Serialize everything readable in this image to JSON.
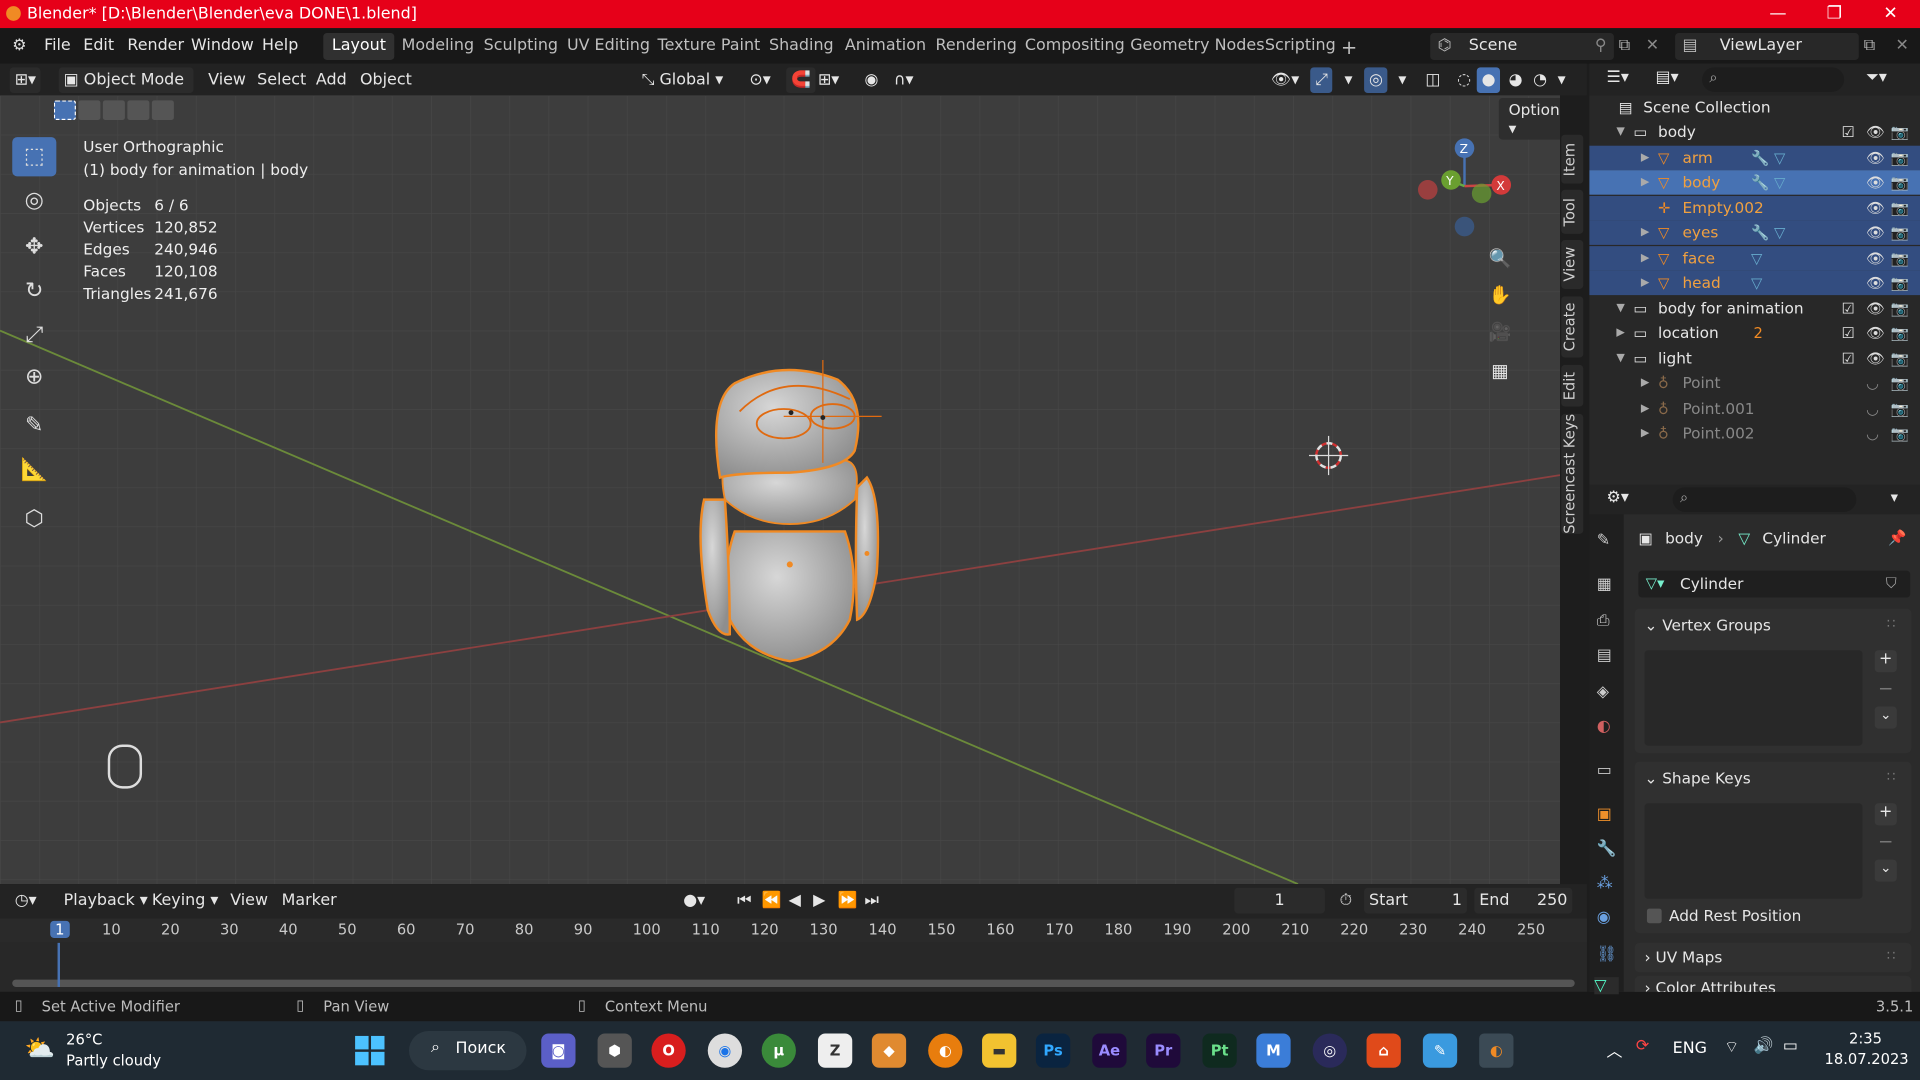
{
  "window": {
    "title": "Blender* [D:\\Blender\\Blender\\eva DONE\\1.blend]"
  },
  "menu": [
    "File",
    "Edit",
    "Render",
    "Window",
    "Help"
  ],
  "workspaces": [
    "Layout",
    "Modeling",
    "Sculpting",
    "UV Editing",
    "Texture Paint",
    "Shading",
    "Animation",
    "Rendering",
    "Compositing",
    "Geometry Nodes",
    "Scripting"
  ],
  "scene": {
    "name": "Scene",
    "view_layer": "ViewLayer"
  },
  "viewport_header": {
    "mode": "Object Mode",
    "menus": [
      "View",
      "Select",
      "Add",
      "Object"
    ],
    "transform": "Global",
    "options": "Options"
  },
  "viewport": {
    "view_name": "User Orthographic",
    "object_info": "(1) body for animation | body",
    "stats": [
      {
        "label": "Objects",
        "value": "6 / 6"
      },
      {
        "label": "Vertices",
        "value": "120,852"
      },
      {
        "label": "Edges",
        "value": "240,946"
      },
      {
        "label": "Faces",
        "value": "120,108"
      },
      {
        "label": "Triangles",
        "value": "241,676"
      }
    ],
    "side_tabs": [
      "Item",
      "Tool",
      "View",
      "Create",
      "Edit",
      "Screencast Keys"
    ],
    "gizmo": {
      "x": "X",
      "y": "Y",
      "z": "Z"
    }
  },
  "outliner": {
    "root": "Scene Collection",
    "rows": [
      {
        "label": "body",
        "type": "collection"
      },
      {
        "label": "arm",
        "type": "mesh",
        "selected": true
      },
      {
        "label": "body",
        "type": "mesh",
        "selected": true,
        "active": true
      },
      {
        "label": "Empty.002",
        "type": "empty",
        "selected": true
      },
      {
        "label": "eyes",
        "type": "mesh",
        "selected": true
      },
      {
        "label": "face",
        "type": "mesh",
        "selected": true
      },
      {
        "label": "head",
        "type": "mesh",
        "selected": true
      },
      {
        "label": "body for animation",
        "type": "collection"
      },
      {
        "label": "location",
        "type": "collection",
        "badge": "2"
      },
      {
        "label": "light",
        "type": "collection"
      },
      {
        "label": "Point",
        "type": "light"
      },
      {
        "label": "Point.001",
        "type": "light"
      },
      {
        "label": "Point.002",
        "type": "light"
      }
    ]
  },
  "properties": {
    "breadcrumb_object": "body",
    "breadcrumb_data": "Cylinder",
    "data_name": "Cylinder",
    "panels": [
      "Vertex Groups",
      "Shape Keys",
      "UV Maps",
      "Color Attributes"
    ],
    "add_rest_position": "Add Rest Position"
  },
  "timeline": {
    "menus": [
      "Playback",
      "Keying",
      "View",
      "Marker"
    ],
    "current_frame": "1",
    "start_label": "Start",
    "start": "1",
    "end_label": "End",
    "end": "250",
    "ticks": [
      "1",
      "10",
      "20",
      "30",
      "40",
      "50",
      "60",
      "70",
      "80",
      "90",
      "100",
      "110",
      "120",
      "130",
      "140",
      "150",
      "160",
      "170",
      "180",
      "190",
      "200",
      "210",
      "220",
      "230",
      "240",
      "250"
    ]
  },
  "statusbar": {
    "left": "Set Active Modifier",
    "middle": "Pan View",
    "right": "Context Menu",
    "version": "3.5.1"
  },
  "taskbar": {
    "weather_temp": "26°C",
    "weather_desc": "Partly cloudy",
    "search": "Поиск",
    "lang": "ENG",
    "time": "2:35",
    "date": "18.07.2023",
    "apps": [
      "Ps",
      "Ae",
      "Pr",
      "Pt",
      "M"
    ]
  },
  "colors": {
    "titlebar": "#e60019",
    "selection": "#4772b3",
    "outline": "#f08a24",
    "accent_orange": "#e08a30"
  }
}
